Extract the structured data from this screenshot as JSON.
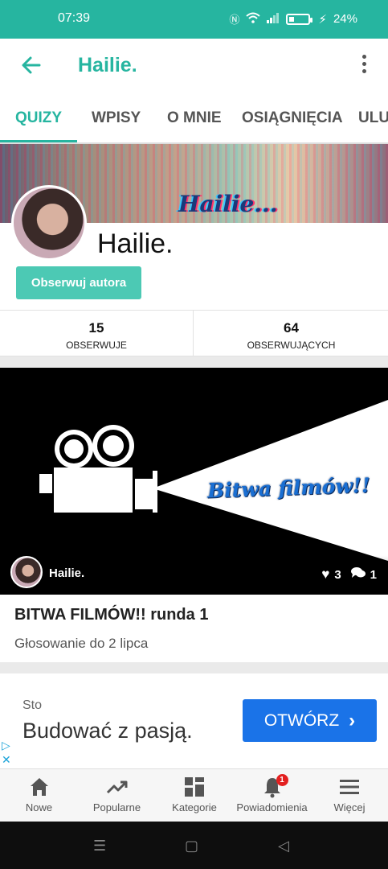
{
  "status_bar": {
    "time": "07:39",
    "battery": "24%"
  },
  "app_bar": {
    "title": "Hailie."
  },
  "tabs": [
    {
      "label": "QUIZY",
      "active": true
    },
    {
      "label": "WPISY"
    },
    {
      "label": "O MNIE"
    },
    {
      "label": "OSIĄGNIĘCIA"
    },
    {
      "label": "ULU"
    }
  ],
  "banner": {
    "text": "Hailie..."
  },
  "profile": {
    "name": "Hailie.",
    "follow_label": "Obserwuj autora",
    "stats": [
      {
        "value": "15",
        "label": "OBSERWUJE"
      },
      {
        "value": "64",
        "label": "OBSERWUJĄCYCH"
      }
    ]
  },
  "card": {
    "art_text": "Bitwa filmów!!",
    "author": "Hailie.",
    "likes": "3",
    "comments": "1",
    "title": "BITWA FILMÓW!! runda 1",
    "subtitle": "Głosowanie do 2 lipca"
  },
  "ad": {
    "brand": "Sto",
    "headline": "Budować z pasją.",
    "cta": "OTWÓRZ"
  },
  "bottom_nav": [
    {
      "label": "Nowe",
      "icon": "home-icon"
    },
    {
      "label": "Popularne",
      "icon": "trending-icon"
    },
    {
      "label": "Kategorie",
      "icon": "grid-icon"
    },
    {
      "label": "Powiadomienia",
      "icon": "bell-icon",
      "badge": "1"
    },
    {
      "label": "Więcej",
      "icon": "menu-icon"
    }
  ],
  "colors": {
    "accent": "#26b5a0",
    "button": "#4cc9b4",
    "ad_cta": "#1a73e8",
    "badge": "#e32020"
  }
}
